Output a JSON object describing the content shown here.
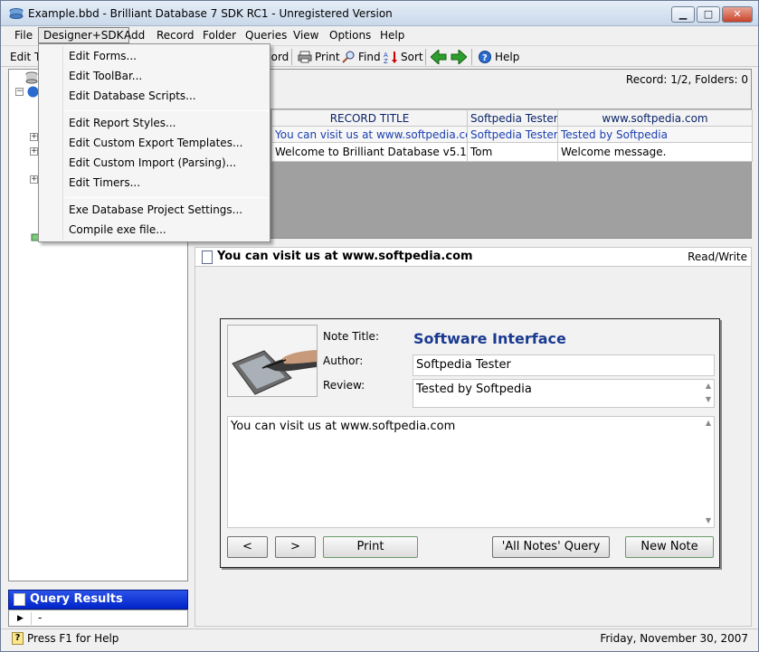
{
  "window": {
    "title": "Example.bbd - Brilliant Database 7 SDK RC1 - Unregistered Version",
    "minimize_glyph": "▁",
    "maximize_glyph": "□",
    "close_glyph": "✕"
  },
  "menubar": {
    "items": [
      "File",
      "Designer+SDK",
      "Add",
      "Record",
      "Folder",
      "Queries",
      "View",
      "Options",
      "Help"
    ]
  },
  "toolbar": {
    "edit_label": "Edit T",
    "record_label": "cord",
    "print_label": "Print",
    "find_label": "Find",
    "sort_label": "Sort",
    "help_label": "Help"
  },
  "dropdown": {
    "items": [
      "Edit Forms...",
      "Edit ToolBar...",
      "Edit Database Scripts...",
      "Edit Report Styles...",
      "Edit Custom Export Templates...",
      "Edit Custom Import (Parsing)...",
      "Edit Timers...",
      "Exe Database Project Settings...",
      "Compile exe file..."
    ]
  },
  "records_panel": {
    "title_fragment": "!",
    "count": "Record: 1/2, Folders: 0",
    "columns": [
      "RECORD TITLE",
      "Softpedia Tester",
      "www.softpedia.com"
    ],
    "rows": [
      [
        "You can visit us at www.softpedia.com",
        "Softpedia Tester",
        "Tested by Softpedia"
      ],
      [
        "Welcome to Brilliant Database v5.1!",
        "Tom",
        "Welcome message."
      ]
    ]
  },
  "note": {
    "header_title": "You can visit us at www.softpedia.com",
    "mode": "Read/Write",
    "labels": {
      "note_title": "Note Title:",
      "author": "Author:",
      "review": "Review:"
    },
    "title_value": "Software Interface",
    "author_value": "Softpedia Tester",
    "review_value": "Tested by Softpedia",
    "body_value": "You can visit us at www.softpedia.com",
    "buttons": {
      "prev": "<",
      "next": ">",
      "print": "Print",
      "all_notes": "'All Notes' Query",
      "new_note": "New Note"
    }
  },
  "left_panel": {
    "query_results_title": "Query Results",
    "query_row_value": "-"
  },
  "statusbar": {
    "help_text": "Press F1 for Help",
    "date": "Friday, November 30, 2007"
  },
  "colors": {
    "query_header": "#0024c8",
    "link_blue": "#1a3fb0",
    "note_title_blue": "#1a3a90"
  }
}
